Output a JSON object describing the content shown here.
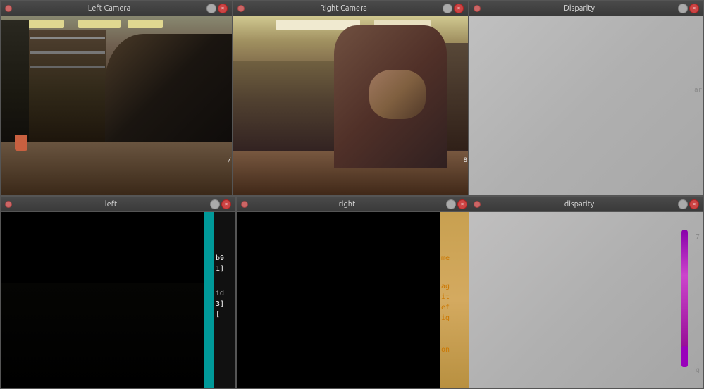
{
  "windows": {
    "left_camera": {
      "title": "Left Camera",
      "dot_color": "#cc4444"
    },
    "right_camera": {
      "title": "Right Camera",
      "dot_color": "#cc4444"
    },
    "disparity_top": {
      "title": "Disparity",
      "dot_color": "#cc4444"
    },
    "left_console": {
      "title": "left",
      "dot_color": "#cc4444"
    },
    "right_console": {
      "title": "right",
      "dot_color": "#cc4444"
    },
    "disparity_bottom": {
      "title": "disparity",
      "dot_color": "#cc4444"
    }
  },
  "controls": {
    "minimize": "–",
    "close": "×"
  },
  "console_left": {
    "lines": [
      "b9",
      "1]",
      "",
      "id",
      "3]",
      "["
    ],
    "color": "#ffffff"
  },
  "console_right": {
    "lines_orange": [
      "me",
      "ag",
      "it",
      "ef",
      "ig",
      "on"
    ],
    "color_orange": "#cc8800"
  },
  "disparity_bottom": {
    "value_right": "7",
    "value_bottom": "g",
    "line_color": "#9900cc"
  }
}
